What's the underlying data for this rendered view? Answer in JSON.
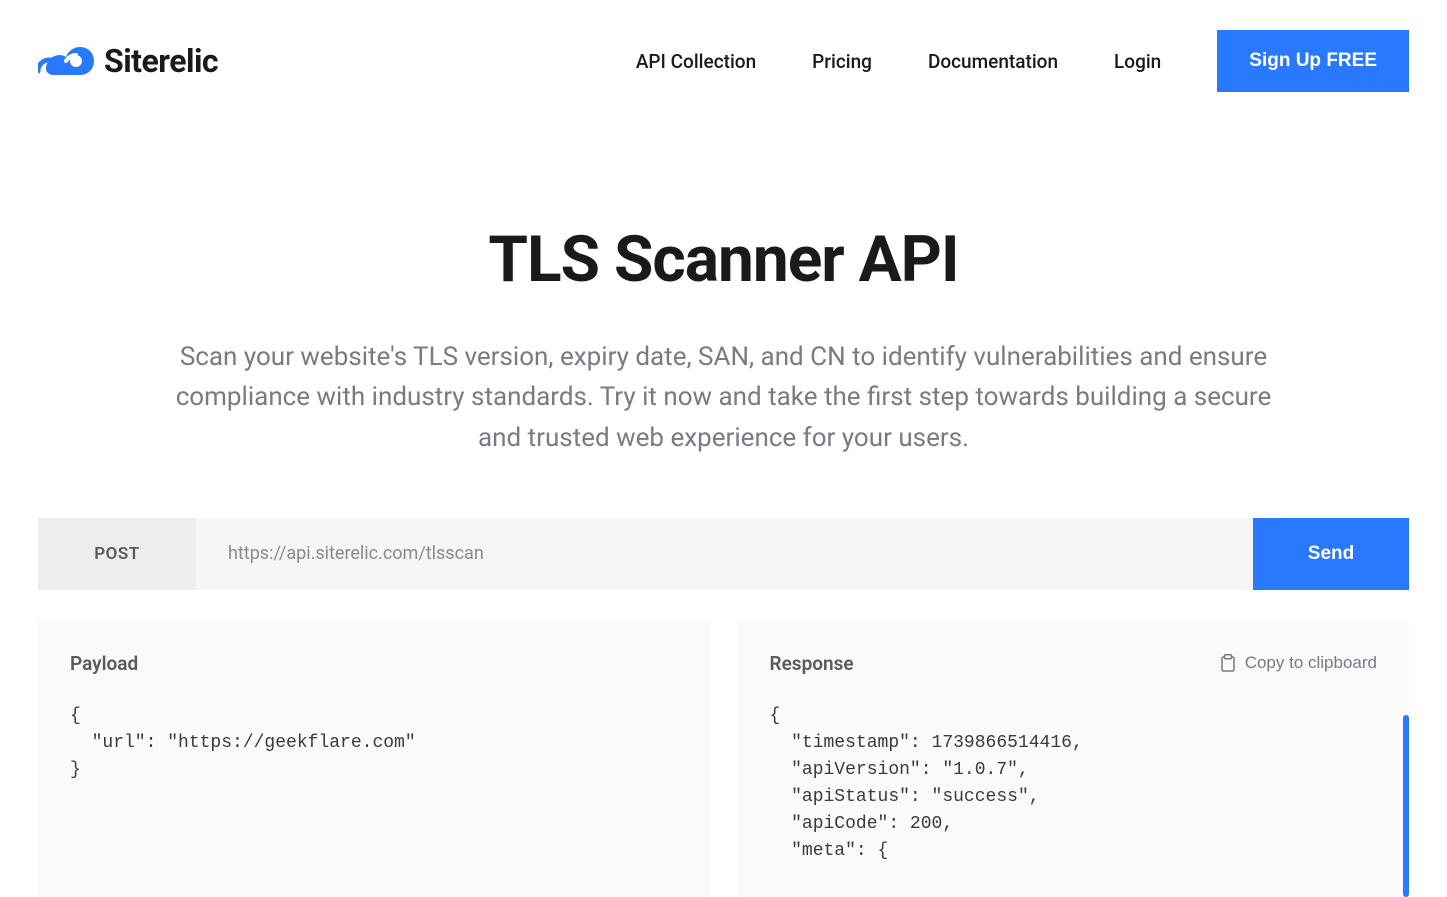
{
  "brand": {
    "name": "Siterelic"
  },
  "nav": {
    "items": [
      "API Collection",
      "Pricing",
      "Documentation",
      "Login"
    ],
    "signup_label": "Sign Up FREE"
  },
  "hero": {
    "title": "TLS Scanner API",
    "subtitle": "Scan your website's TLS version, expiry date, SAN, and CN to identify vulnerabilities and ensure compliance with industry standards. Try it now and take the first step towards building a secure and trusted web experience for your users."
  },
  "request": {
    "method": "POST",
    "url": "https://api.siterelic.com/tlsscan",
    "send_label": "Send"
  },
  "payload": {
    "label": "Payload",
    "code": "{\n  \"url\": \"https://geekflare.com\"\n}"
  },
  "response": {
    "label": "Response",
    "copy_label": "Copy to clipboard",
    "code": "{\n  \"timestamp\": 1739866514416,\n  \"apiVersion\": \"1.0.7\",\n  \"apiStatus\": \"success\",\n  \"apiCode\": 200,\n  \"meta\": {"
  }
}
